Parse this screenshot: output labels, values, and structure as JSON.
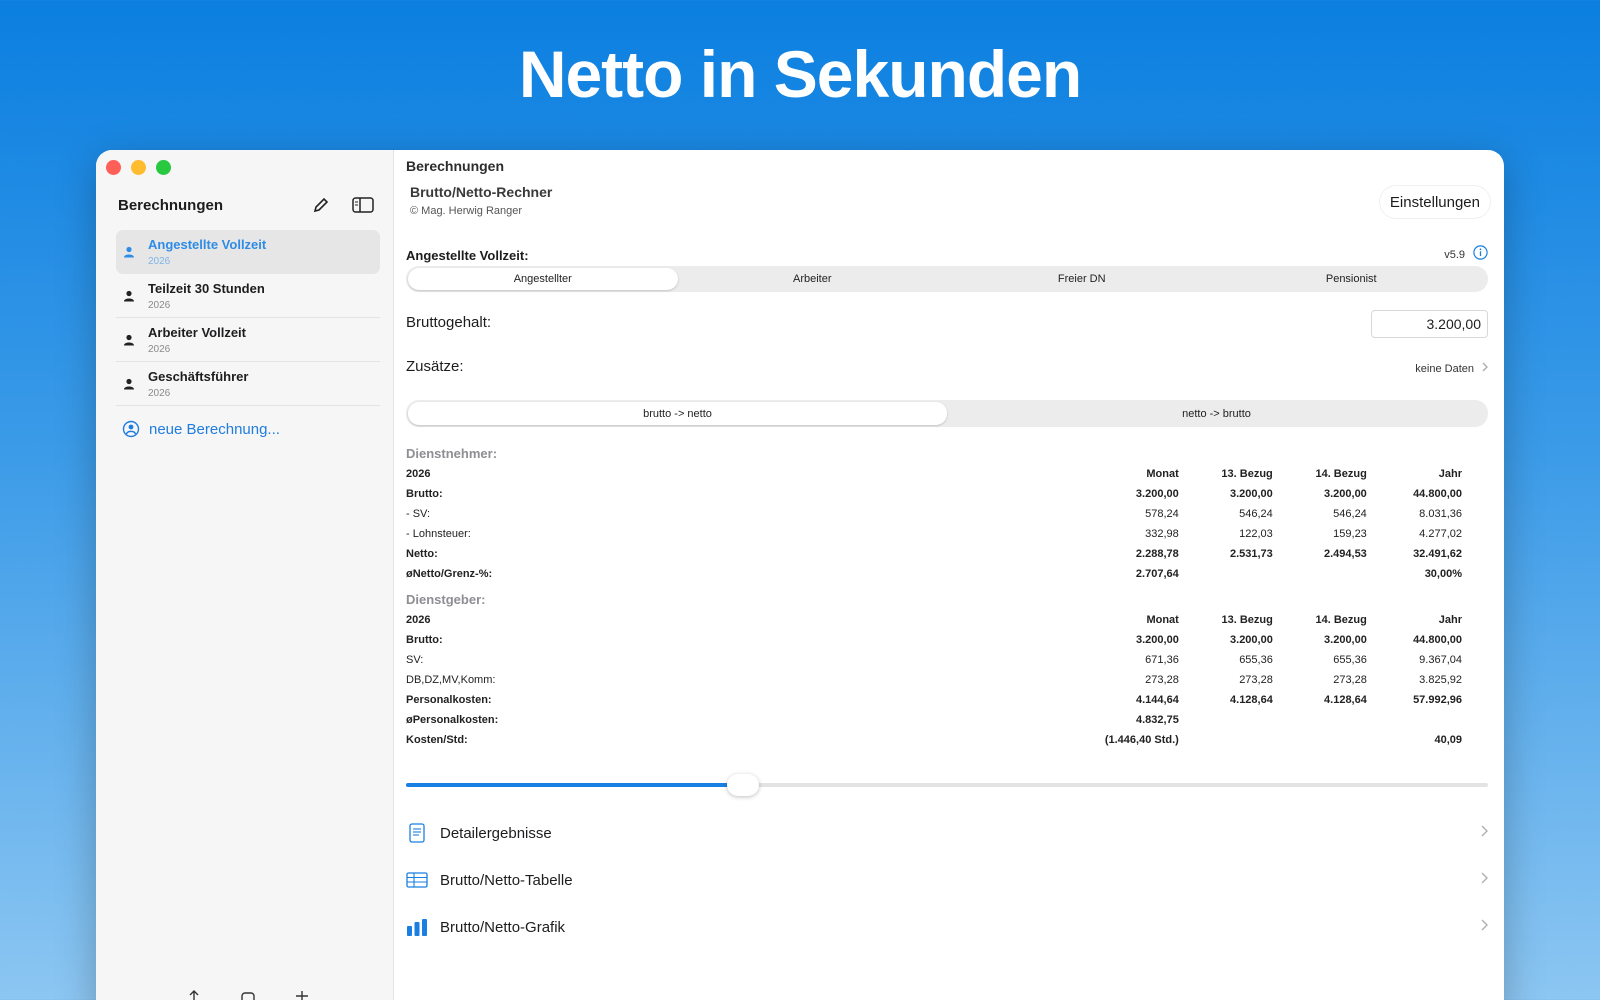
{
  "hero": {
    "title": "Netto in Sekunden"
  },
  "sidebar": {
    "title": "Berechnungen",
    "items": [
      {
        "name": "Angestellte Vollzeit",
        "year": "2026"
      },
      {
        "name": "Teilzeit 30 Stunden",
        "year": "2026"
      },
      {
        "name": "Arbeiter Vollzeit",
        "year": "2026"
      },
      {
        "name": "Geschäftsführer",
        "year": "2026"
      }
    ],
    "new_label": "neue Berechnung..."
  },
  "main": {
    "window_title": "Berechnungen",
    "app_name": "Brutto/Netto-Rechner",
    "copyright": "© Mag. Herwig Ranger",
    "settings_label": "Einstellungen",
    "section_label": "Angestellte Vollzeit:",
    "version": "v5.9",
    "employment_types": [
      "Angestellter",
      "Arbeiter",
      "Freier DN",
      "Pensionist"
    ],
    "brutto_label": "Bruttogehalt:",
    "brutto_value": "3.200,00",
    "zusaetze_label": "Zusätze:",
    "zusaetze_value": "keine Daten",
    "directions": [
      "brutto -> netto",
      "netto -> brutto"
    ],
    "employee": {
      "title": "Dienstnehmer:",
      "header": [
        "2026",
        "Monat",
        "13. Bezug",
        "14. Bezug",
        "Jahr"
      ],
      "rows": [
        [
          "Brutto:",
          "3.200,00",
          "3.200,00",
          "3.200,00",
          "44.800,00"
        ],
        [
          "- SV:",
          "578,24",
          "546,24",
          "546,24",
          "8.031,36"
        ],
        [
          "- Lohnsteuer:",
          "332,98",
          "122,03",
          "159,23",
          "4.277,02"
        ],
        [
          "Netto:",
          "2.288,78",
          "2.531,73",
          "2.494,53",
          "32.491,62"
        ],
        [
          "øNetto/Grenz-%:",
          "2.707,64",
          "",
          "",
          "30,00%"
        ]
      ]
    },
    "employer": {
      "title": "Dienstgeber:",
      "header": [
        "2026",
        "Monat",
        "13. Bezug",
        "14. Bezug",
        "Jahr"
      ],
      "rows": [
        [
          "Brutto:",
          "3.200,00",
          "3.200,00",
          "3.200,00",
          "44.800,00"
        ],
        [
          "SV:",
          "671,36",
          "655,36",
          "655,36",
          "9.367,04"
        ],
        [
          "DB,DZ,MV,Komm:",
          "273,28",
          "273,28",
          "273,28",
          "3.825,92"
        ],
        [
          "Personalkosten:",
          "4.144,64",
          "4.128,64",
          "4.128,64",
          "57.992,96"
        ],
        [
          "øPersonalkosten:",
          "4.832,75",
          "",
          "",
          ""
        ],
        [
          "Kosten/Std:",
          "(1.446,40 Std.)",
          "",
          "",
          "40,09"
        ]
      ]
    },
    "slider_fraction": 0.31,
    "links": [
      "Detailergebnisse",
      "Brutto/Netto-Tabelle",
      "Brutto/Netto-Grafik"
    ]
  },
  "colors": {
    "accent": "#1a7fe3",
    "background_top": "#0b7fe0"
  }
}
